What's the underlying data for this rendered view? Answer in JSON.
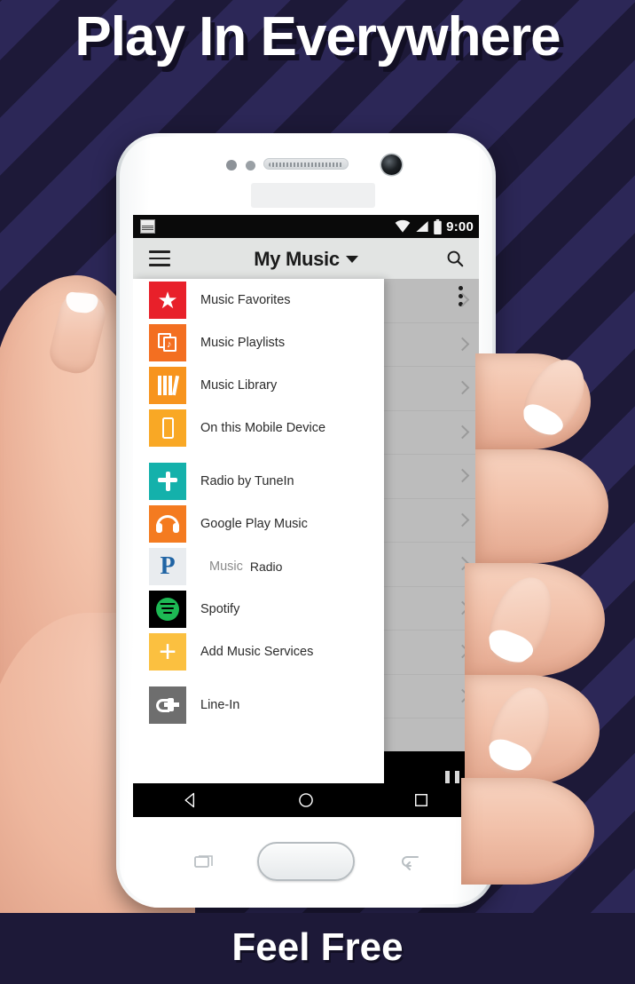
{
  "poster": {
    "headline": "Play In Everywhere",
    "footer_caption": "Feel Free",
    "bg_color": "#1d1938",
    "stripe_color": "#2c2757"
  },
  "phone": {
    "statusbar": {
      "app_icon": "sonos-notification-icon",
      "wifi_icon": "wifi-icon",
      "signal_icon": "signal-bars-icon",
      "battery_icon": "battery-icon",
      "time": "9:00"
    },
    "appbar": {
      "menu_icon": "hamburger-menu-icon",
      "title": "My Music",
      "dropdown_icon": "caret-down-icon",
      "search_icon": "search-icon"
    },
    "navbar": {
      "back_icon": "back-triangle-icon",
      "home_icon": "home-circle-icon",
      "recents_icon": "recents-square-icon"
    },
    "bezel": {
      "recents_icon": "recents-icon",
      "home_button": "home-button",
      "back_icon": "back-icon"
    }
  },
  "drawer": {
    "items": [
      {
        "label": "Music Favorites",
        "icon": "star-icon",
        "tile": "t-fav",
        "color": "#e8202a"
      },
      {
        "label": "Music Playlists",
        "icon": "playlist-icon",
        "tile": "t-playlists",
        "color": "#f36f21"
      },
      {
        "label": "Music Library",
        "icon": "library-bars-icon",
        "tile": "t-library",
        "color": "#f7941e"
      },
      {
        "label": "On this Mobile Device",
        "icon": "mobile-phone-icon",
        "tile": "t-device",
        "color": "#f9a825"
      },
      {
        "label": "Radio by TuneIn",
        "icon": "tunein-icon",
        "tile": "t-tunein",
        "color": "#14b1ab"
      },
      {
        "label": "Google Play Music",
        "icon": "headphones-icon",
        "tile": "t-gpm",
        "color": "#f47b20"
      },
      {
        "label": "Music Radio",
        "icon": "pandora-p-icon",
        "tile": "t-pandora",
        "color": "#e9ecef",
        "label_part1": "Music",
        "label_part2": "Radio"
      },
      {
        "label": "Spotify",
        "icon": "spotify-icon",
        "tile": "t-spotify",
        "color": "#000000"
      },
      {
        "label": "Add Music Services",
        "icon": "plus-icon",
        "tile": "t-add",
        "color": "#fbc040"
      },
      {
        "label": "Line-In",
        "icon": "line-in-plug-icon",
        "tile": "t-linein",
        "color": "#6e6e6e"
      }
    ]
  },
  "background_list": {
    "overflow_icon": "overflow-menu-icon",
    "row_chevron_icon": "chevron-right-icon",
    "row_count": 10
  },
  "now_playing": {
    "pause_icon": "pause-icon"
  }
}
